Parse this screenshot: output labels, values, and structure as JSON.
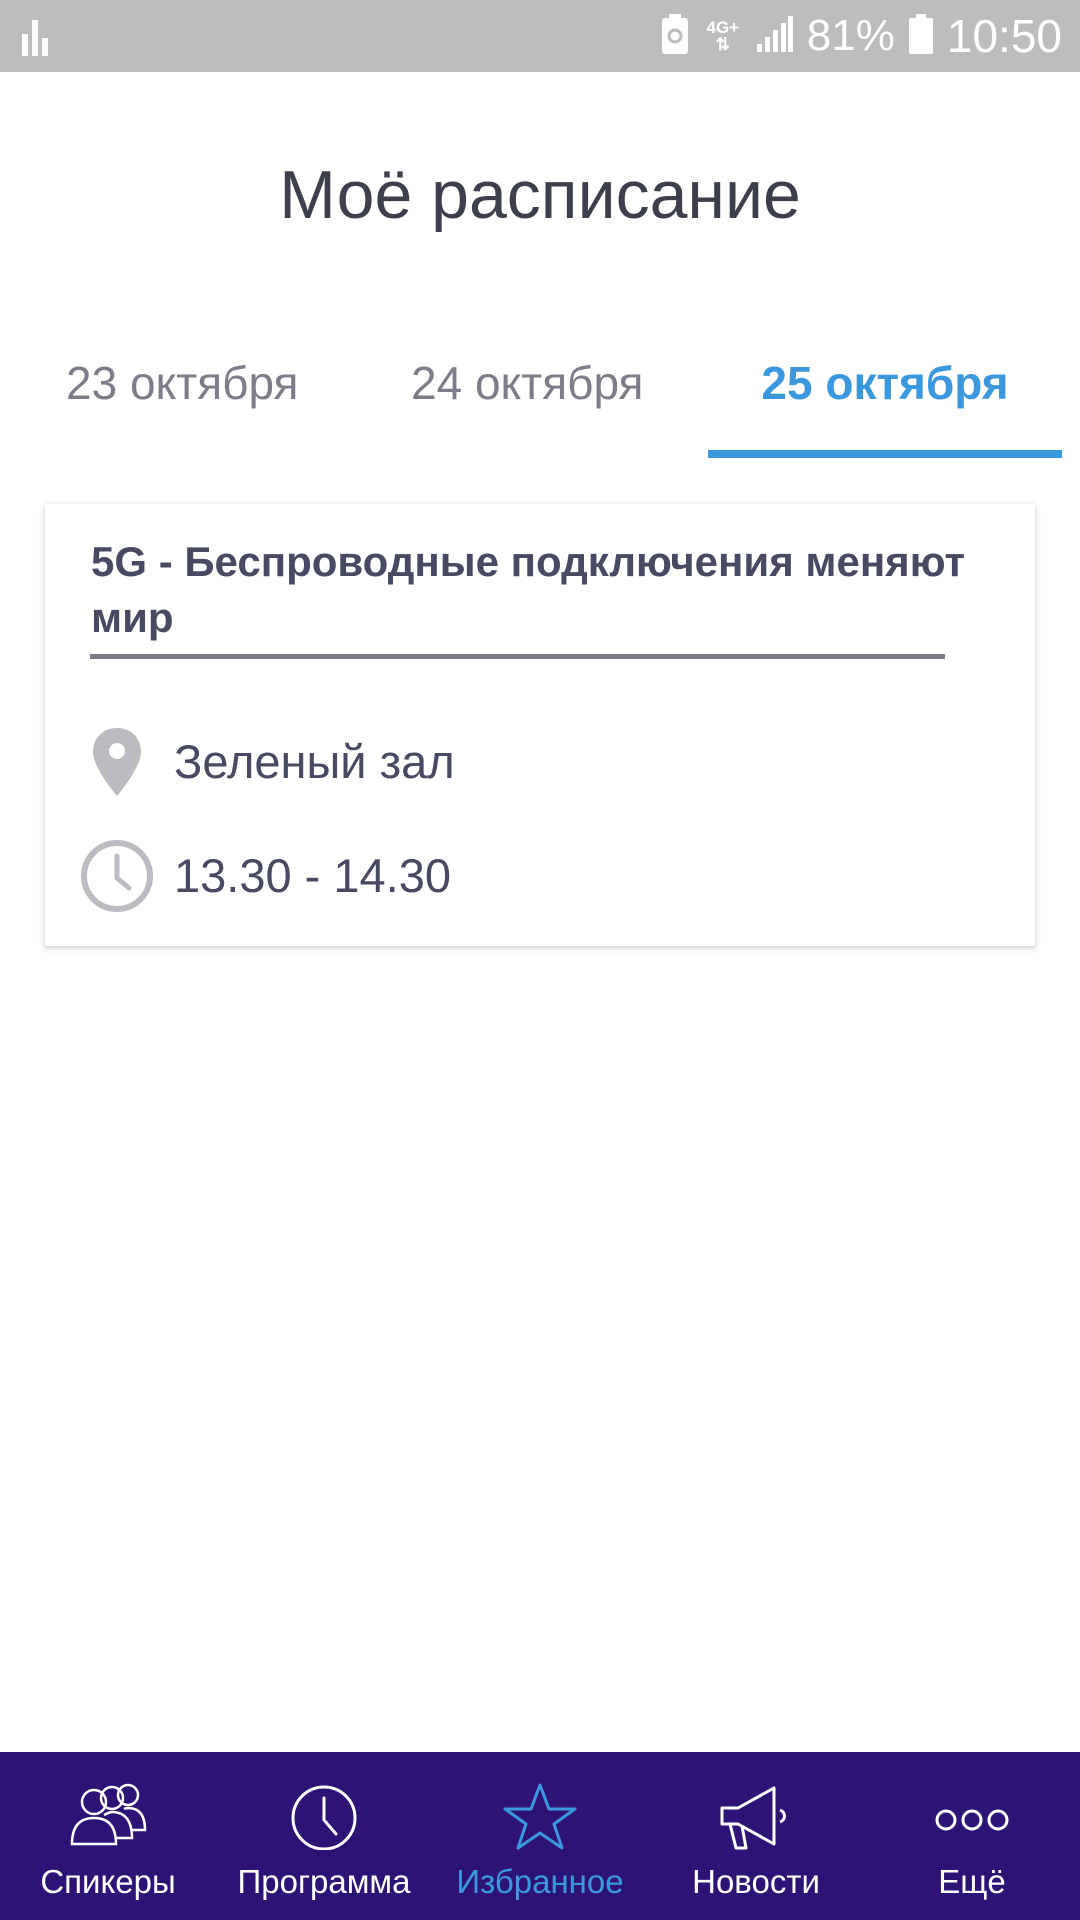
{
  "status_bar": {
    "network": "4G+",
    "battery": "81%",
    "time": "10:50"
  },
  "header": {
    "title": "Моё расписание"
  },
  "tabs": [
    {
      "label": "23 октября",
      "active": false
    },
    {
      "label": "24 октября",
      "active": false
    },
    {
      "label": "25 октября",
      "active": true
    }
  ],
  "events": [
    {
      "title": "5G - Беспроводные подключения меняют мир",
      "location": "Зеленый зал",
      "time": "13.30 - 14.30"
    }
  ],
  "bottom_nav": [
    {
      "label": "Спикеры",
      "icon": "speakers-icon",
      "active": false
    },
    {
      "label": "Программа",
      "icon": "clock-icon",
      "active": false
    },
    {
      "label": "Избранное",
      "icon": "star-icon",
      "active": true
    },
    {
      "label": "Новости",
      "icon": "megaphone-icon",
      "active": false
    },
    {
      "label": "Ещё",
      "icon": "more-icon",
      "active": false
    }
  ],
  "colors": {
    "accent": "#3b98de",
    "nav_background": "#2e1377",
    "status_bar": "#bdbdbd",
    "text_dark": "#474a62",
    "text_muted": "#7c7d88"
  }
}
